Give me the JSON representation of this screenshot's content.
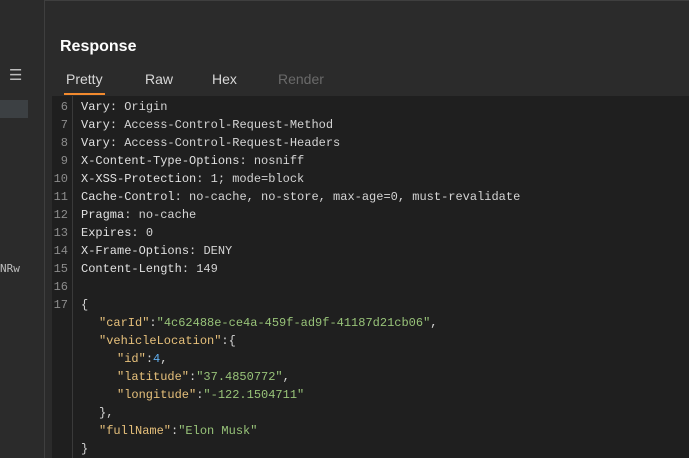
{
  "left": {
    "menu_icon": "hamburger-menu-icon",
    "fragment_text": "NRw"
  },
  "title": "Response",
  "tabs": [
    {
      "label": "Pretty",
      "active": true
    },
    {
      "label": "Raw",
      "active": false
    },
    {
      "label": "Hex",
      "active": false
    },
    {
      "label": "Render",
      "active": false,
      "disabled": true
    }
  ],
  "headers": [
    {
      "num": "6",
      "name": "Vary",
      "value": "Origin"
    },
    {
      "num": "7",
      "name": "Vary",
      "value": "Access-Control-Request-Method"
    },
    {
      "num": "8",
      "name": "Vary",
      "value": "Access-Control-Request-Headers"
    },
    {
      "num": "9",
      "name": "X-Content-Type-Options",
      "value": "nosniff"
    },
    {
      "num": "10",
      "name": "X-XSS-Protection",
      "value": "1; mode=block"
    },
    {
      "num": "11",
      "name": "Cache-Control",
      "value": "no-cache, no-store, max-age=0, must-revalidate"
    },
    {
      "num": "12",
      "name": "Pragma",
      "value": "no-cache"
    },
    {
      "num": "13",
      "name": "Expires",
      "value": "0"
    },
    {
      "num": "14",
      "name": "X-Frame-Options",
      "value": "DENY"
    },
    {
      "num": "15",
      "name": "Content-Length",
      "value": "149"
    }
  ],
  "blank_line_num": "16",
  "body_line_num": "17",
  "json_body": {
    "open_brace": "{",
    "car_id_key": "\"carId\"",
    "car_id_value": "\"4c62488e-ce4a-459f-ad9f-41187d21cb06\"",
    "vehicle_location_key": "\"vehicleLocation\"",
    "vehicle_location_open": "{",
    "id_key": "\"id\"",
    "id_value": "4",
    "latitude_key": "\"latitude\"",
    "latitude_value": "\"37.4850772\"",
    "longitude_key": "\"longitude\"",
    "longitude_value": "\"-122.1504711\"",
    "vehicle_location_close": "},",
    "full_name_key": "\"fullName\"",
    "full_name_value": "\"Elon Musk\"",
    "close_brace": "}"
  }
}
